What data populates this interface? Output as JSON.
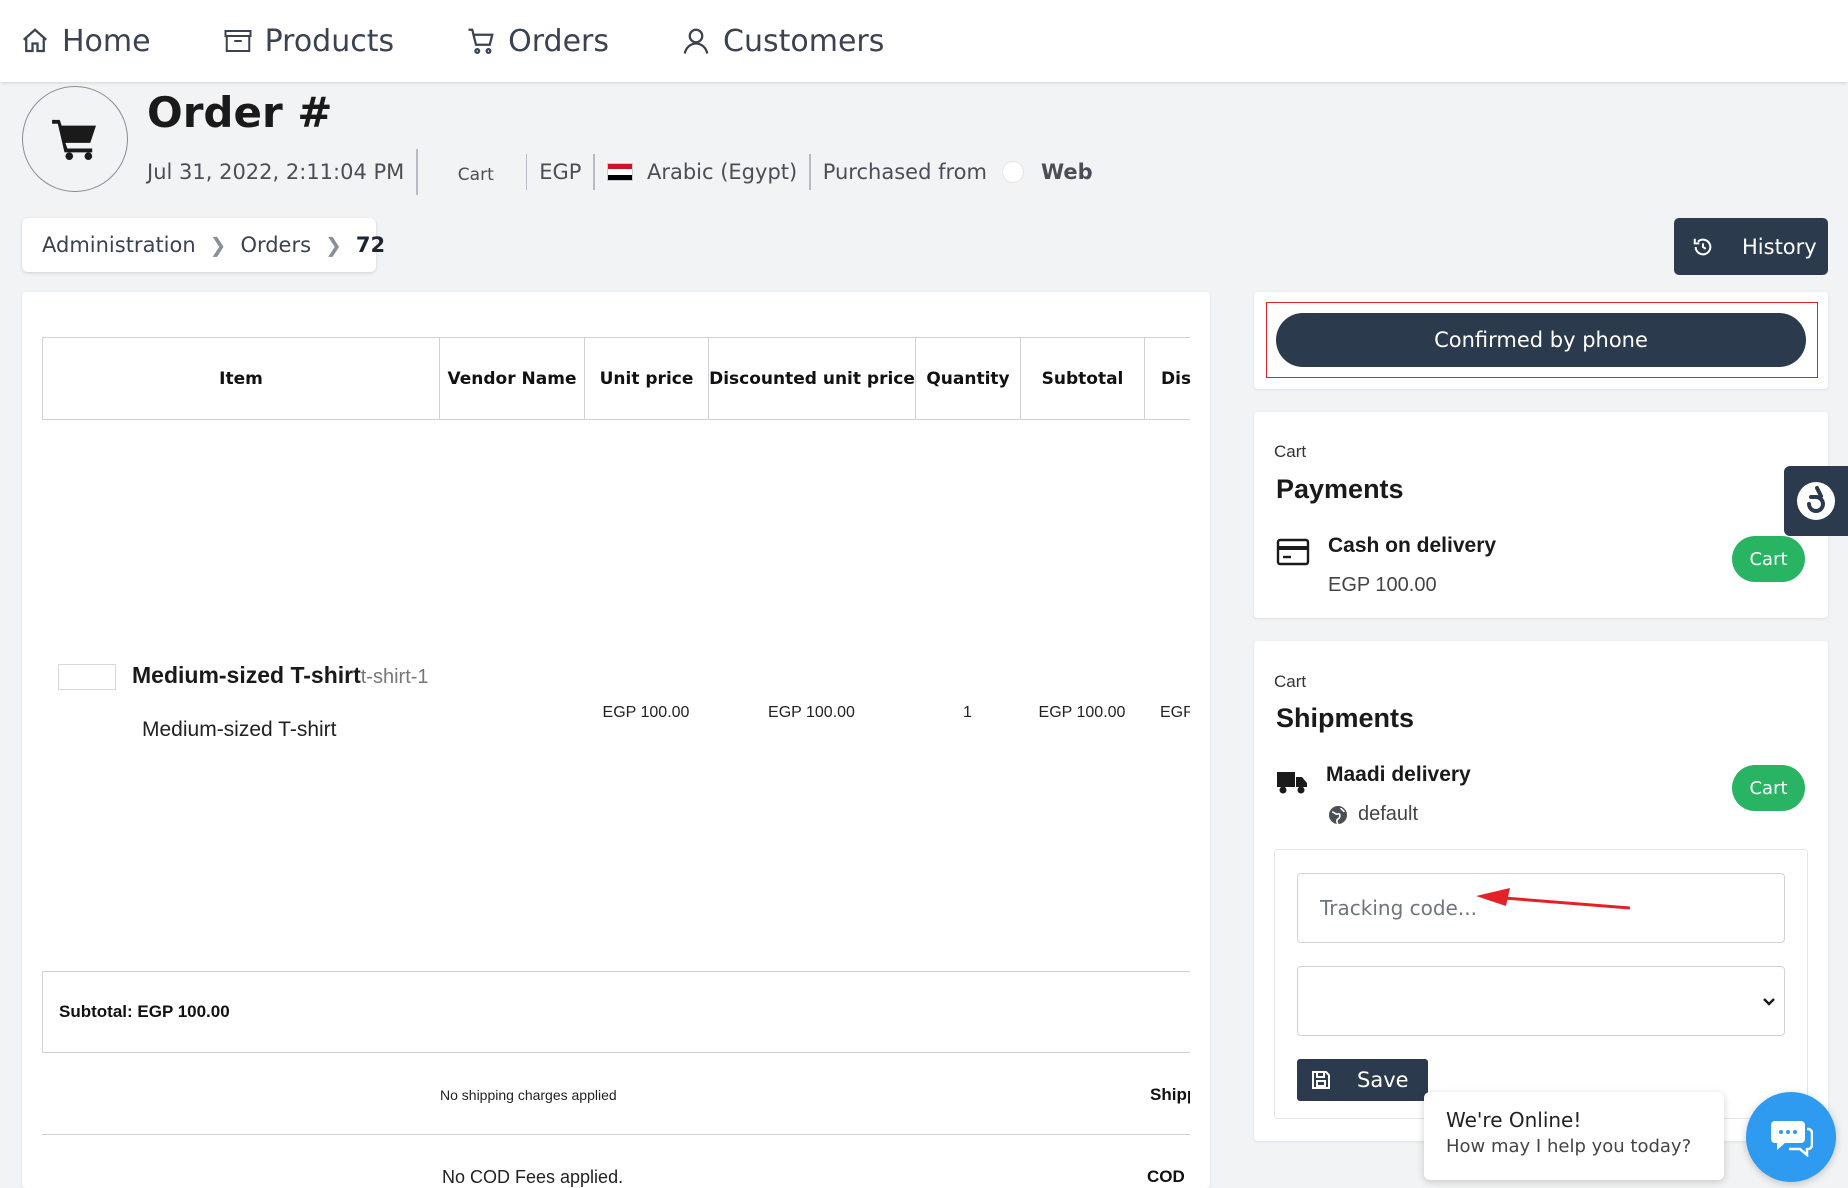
{
  "nav": {
    "items": [
      {
        "label": "Home",
        "icon": "home-icon"
      },
      {
        "label": "Products",
        "icon": "box-icon"
      },
      {
        "label": "Orders",
        "icon": "cart-icon"
      },
      {
        "label": "Customers",
        "icon": "user-icon"
      }
    ]
  },
  "header": {
    "title": "Order #",
    "date": "Jul 31, 2022, 2:11:04 PM",
    "stage": "Cart",
    "currency": "EGP",
    "locale": "Arabic (Egypt)",
    "purchased_from_label": "Purchased from",
    "channel": "Web"
  },
  "breadcrumb": {
    "items": [
      "Administration",
      "Orders",
      "72"
    ]
  },
  "history_button": "History",
  "status_button": "Confirmed by phone",
  "table": {
    "columns": [
      "Item",
      "Vendor Name",
      "Unit price",
      "Discounted unit price",
      "Quantity",
      "Subtotal",
      "Discount"
    ],
    "row": {
      "name": "Medium-sized T-shirt",
      "sku": "t-shirt-1",
      "description": "Medium-sized T-shirt",
      "vendor": "",
      "unit_price": "EGP 100.00",
      "discounted_unit_price": "EGP 100.00",
      "quantity": "1",
      "subtotal": "EGP 100.00",
      "discount": "EGP"
    },
    "subtotal_label": "Subtotal: EGP 100.00",
    "shipping_note": "No shipping charges applied",
    "shipping_label": "Shipping",
    "cod_note": "No COD Fees applied.",
    "cod_label": "COD"
  },
  "payments": {
    "stage": "Cart",
    "title": "Payments",
    "method": "Cash on delivery",
    "amount": "EGP 100.00",
    "badge": "Cart"
  },
  "shipments": {
    "stage": "Cart",
    "title": "Shipments",
    "method": "Maadi delivery",
    "zone": "default",
    "badge": "Cart",
    "tracking_placeholder": "Tracking code...",
    "save_label": "Save"
  },
  "chat": {
    "title": "We're Online!",
    "subtitle": "How may I help you today?"
  },
  "colors": {
    "navy": "#2c3a4d",
    "green": "#28b463",
    "highlight": "#e42127",
    "chat": "#2e9bf0"
  }
}
